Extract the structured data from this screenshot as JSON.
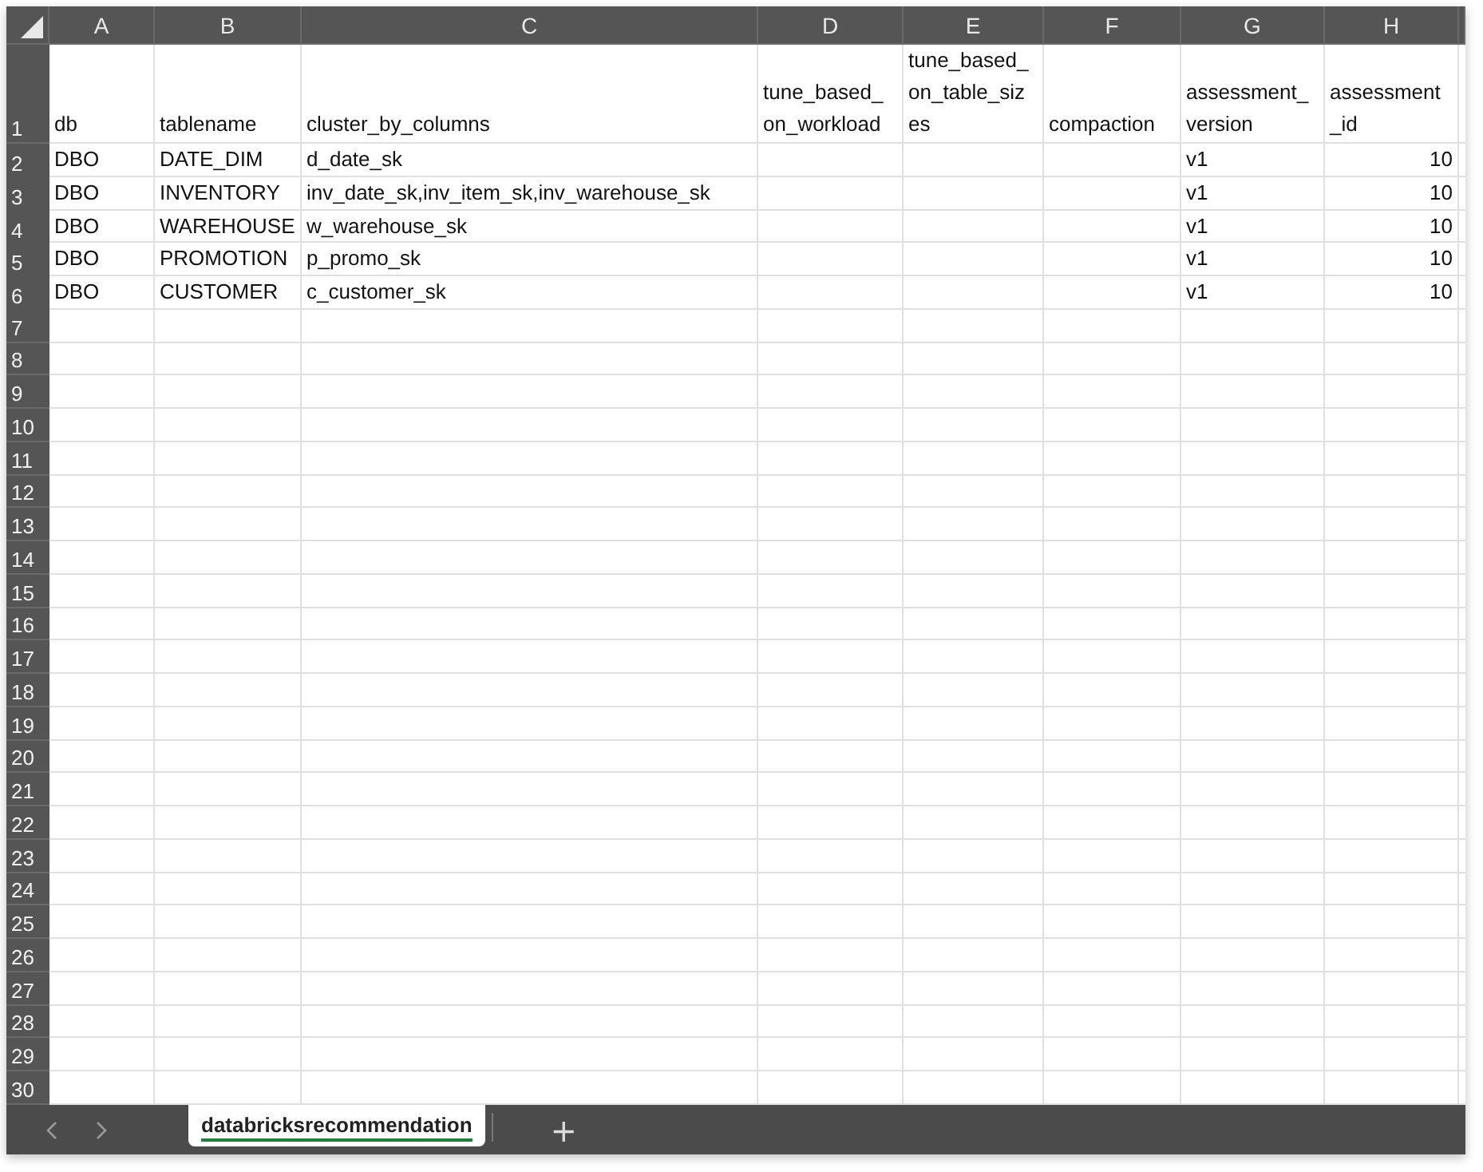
{
  "columns": [
    {
      "letter": "A"
    },
    {
      "letter": "B"
    },
    {
      "letter": "C"
    },
    {
      "letter": "D"
    },
    {
      "letter": "E"
    },
    {
      "letter": "F"
    },
    {
      "letter": "G"
    },
    {
      "letter": "H"
    }
  ],
  "rows": [
    {
      "number": "1",
      "cells": {
        "A": {
          "text": "db",
          "kind": "text"
        },
        "B": {
          "text": "tablename",
          "kind": "text"
        },
        "C": {
          "text": "cluster_by_columns",
          "kind": "text"
        },
        "D": {
          "text": "tune_based_on_workload",
          "kind": "text"
        },
        "E": {
          "text": "tune_based_on_table_sizes",
          "kind": "text"
        },
        "F": {
          "text": "compaction",
          "kind": "text"
        },
        "G": {
          "text": "assessment_version",
          "kind": "text"
        },
        "H": {
          "text": "assessment_id",
          "kind": "text"
        }
      }
    },
    {
      "number": "2",
      "cells": {
        "A": {
          "text": "DBO",
          "kind": "text"
        },
        "B": {
          "text": "DATE_DIM",
          "kind": "text"
        },
        "C": {
          "text": "d_date_sk",
          "kind": "text"
        },
        "G": {
          "text": "v1",
          "kind": "text"
        },
        "H": {
          "text": "10",
          "kind": "number"
        }
      }
    },
    {
      "number": "3",
      "cells": {
        "A": {
          "text": "DBO",
          "kind": "text"
        },
        "B": {
          "text": "INVENTORY",
          "kind": "text"
        },
        "C": {
          "text": "inv_date_sk,inv_item_sk,inv_warehouse_sk",
          "kind": "text"
        },
        "G": {
          "text": "v1",
          "kind": "text"
        },
        "H": {
          "text": "10",
          "kind": "number"
        }
      }
    },
    {
      "number": "4",
      "cells": {
        "A": {
          "text": "DBO",
          "kind": "text"
        },
        "B": {
          "text": "WAREHOUSE",
          "kind": "text"
        },
        "C": {
          "text": "w_warehouse_sk",
          "kind": "text"
        },
        "G": {
          "text": "v1",
          "kind": "text"
        },
        "H": {
          "text": "10",
          "kind": "number"
        }
      }
    },
    {
      "number": "5",
      "cells": {
        "A": {
          "text": "DBO",
          "kind": "text"
        },
        "B": {
          "text": "PROMOTION",
          "kind": "text"
        },
        "C": {
          "text": "p_promo_sk",
          "kind": "text"
        },
        "G": {
          "text": "v1",
          "kind": "text"
        },
        "H": {
          "text": "10",
          "kind": "number"
        }
      }
    },
    {
      "number": "6",
      "cells": {
        "A": {
          "text": "DBO",
          "kind": "text"
        },
        "B": {
          "text": "CUSTOMER",
          "kind": "text"
        },
        "C": {
          "text": "c_customer_sk",
          "kind": "text"
        },
        "G": {
          "text": "v1",
          "kind": "text"
        },
        "H": {
          "text": "10",
          "kind": "number"
        }
      }
    },
    {
      "number": "7"
    },
    {
      "number": "8"
    },
    {
      "number": "9"
    },
    {
      "number": "10"
    },
    {
      "number": "11"
    },
    {
      "number": "12"
    },
    {
      "number": "13"
    },
    {
      "number": "14"
    },
    {
      "number": "15"
    },
    {
      "number": "16"
    },
    {
      "number": "17"
    },
    {
      "number": "18"
    },
    {
      "number": "19"
    },
    {
      "number": "20"
    },
    {
      "number": "21"
    },
    {
      "number": "22"
    },
    {
      "number": "23"
    },
    {
      "number": "24"
    },
    {
      "number": "25"
    },
    {
      "number": "26"
    },
    {
      "number": "27"
    },
    {
      "number": "28"
    },
    {
      "number": "29"
    },
    {
      "number": "30"
    }
  ],
  "sheet_tabs": [
    {
      "label": "databricksrecommendation",
      "selected": true
    }
  ],
  "add_sheet": "+"
}
